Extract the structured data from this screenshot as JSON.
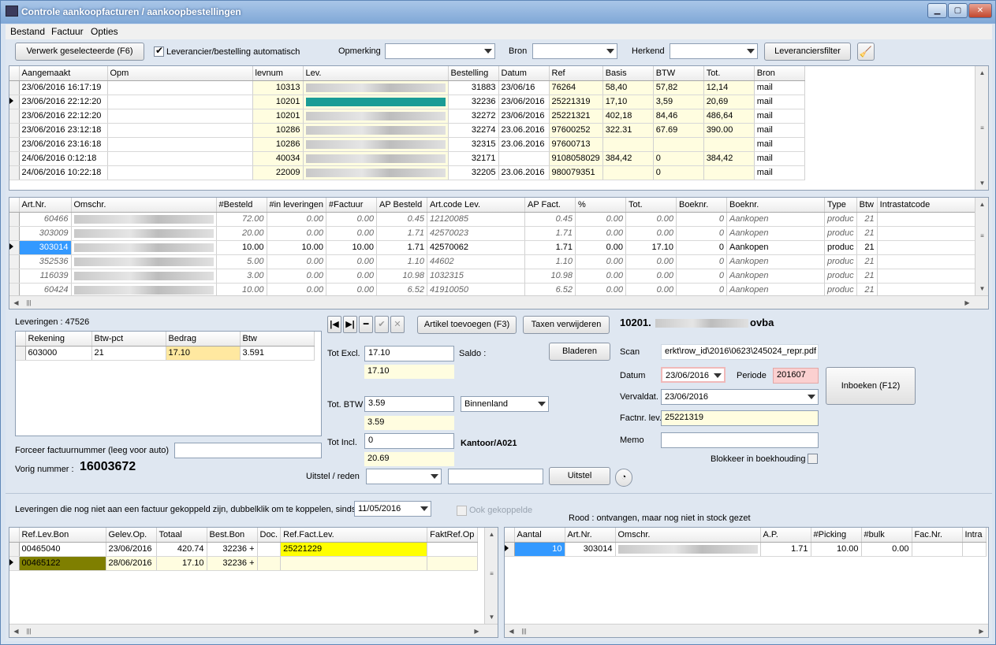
{
  "window": {
    "title": "Controle aankoopfacturen / aankoopbestellingen"
  },
  "menu": [
    "Bestand",
    "Factuur",
    "Opties"
  ],
  "toolbar": {
    "process_btn": "Verwerk geselecteerde (F6)",
    "auto_label": "Leverancier/bestelling automatisch",
    "opmerking": "Opmerking",
    "bron": "Bron",
    "herkend": "Herkend",
    "supplier_filter": "Leveranciersfilter"
  },
  "invoices": {
    "cols": [
      "Aangemaakt",
      "Opm",
      "levnum",
      "Lev.",
      "Bestelling",
      "Datum",
      "Ref",
      "Basis",
      "BTW",
      "Tot.",
      "Bron"
    ],
    "rows": [
      [
        "23/06/2016 16:17:19",
        "",
        "10313",
        "",
        "31883",
        "23/06/16",
        "76264",
        "58,40",
        "57,82",
        "12,14",
        "mail"
      ],
      [
        "23/06/2016 22:12:20",
        "",
        "10201",
        "",
        "32236",
        "23/06/2016",
        "25221319",
        "17,10",
        "3,59",
        "20,69",
        "mail"
      ],
      [
        "23/06/2016 22:12:20",
        "",
        "10201",
        "",
        "32272",
        "23/06/2016",
        "25221321",
        "402,18",
        "84,46",
        "486,64",
        "mail"
      ],
      [
        "23/06/2016 23:12:18",
        "",
        "10286",
        "",
        "32274",
        "23.06.2016",
        "97600252",
        "322.31",
        "67.69",
        "390.00",
        "mail"
      ],
      [
        "23/06/2016 23:16:18",
        "",
        "10286",
        "",
        "32315",
        "23.06.2016",
        "97600713",
        "",
        "",
        "",
        "mail"
      ],
      [
        "24/06/2016 0:12:18",
        "",
        "40034",
        "",
        "32171",
        "",
        "9108058029",
        "384,42",
        "0",
        "384,42",
        "mail"
      ],
      [
        "24/06/2016 10:22:18",
        "",
        "22009",
        "",
        "32205",
        "23.06.2016",
        "980079351",
        "",
        "0",
        "",
        "mail"
      ]
    ]
  },
  "lines": {
    "cols": [
      "Art.Nr.",
      "Omschr.",
      "#Besteld",
      "#in leveringen",
      "#Factuur",
      "AP Besteld",
      "Art.code Lev.",
      "AP Fact.",
      "%",
      "Tot.",
      "Boeknr.",
      "Boeknr.",
      "Type",
      "Btw",
      "Intrastatcode"
    ],
    "rows": [
      [
        "60466",
        "",
        "72.00",
        "0.00",
        "0.00",
        "0.45",
        "12120085",
        "0.45",
        "0.00",
        "0.00",
        "0",
        "Aankopen",
        "produc",
        "21",
        ""
      ],
      [
        "303009",
        "",
        "20.00",
        "0.00",
        "0.00",
        "1.71",
        "42570023",
        "1.71",
        "0.00",
        "0.00",
        "0",
        "Aankopen",
        "produc",
        "21",
        ""
      ],
      [
        "303014",
        "",
        "10.00",
        "10.00",
        "10.00",
        "1.71",
        "42570062",
        "1.71",
        "0.00",
        "17.10",
        "0",
        "Aankopen",
        "produc",
        "21",
        ""
      ],
      [
        "352536",
        "",
        "5.00",
        "0.00",
        "0.00",
        "1.10",
        "44602",
        "1.10",
        "0.00",
        "0.00",
        "0",
        "Aankopen",
        "produc",
        "21",
        ""
      ],
      [
        "116039",
        "",
        "3.00",
        "0.00",
        "0.00",
        "10.98",
        "1032315",
        "10.98",
        "0.00",
        "0.00",
        "0",
        "Aankopen",
        "produc",
        "21",
        ""
      ],
      [
        "60424",
        "",
        "10.00",
        "0.00",
        "0.00",
        "6.52",
        "41910050",
        "6.52",
        "0.00",
        "0.00",
        "0",
        "Aankopen",
        "produc",
        "21",
        ""
      ]
    ]
  },
  "leveringen": {
    "label": "Leveringen : 47526",
    "cols": [
      "Rekening",
      "Btw-pct",
      "Bedrag",
      "Btw"
    ],
    "rows": [
      [
        "603000",
        "21",
        "17.10",
        "3.591"
      ]
    ]
  },
  "buttons": {
    "add_article": "Artikel toevoegen (F3)",
    "remove_tax": "Taxen verwijderen",
    "browse": "Bladeren",
    "book": "Inboeken (F12)",
    "delay": "Uitstel"
  },
  "totals": {
    "excl_label": "Tot Excl.",
    "excl": "17.10",
    "excl_calc": "17.10",
    "saldo": "Saldo :",
    "btw_label": "Tot. BTW",
    "btw": "3.59",
    "btw_calc": "3.59",
    "region": "Binnenland",
    "incl_label": "Tot Incl.",
    "incl": "0",
    "incl_calc": "20.69",
    "kantoor": "Kantoor/A021",
    "uitstel_label": "Uitstel / reden"
  },
  "supplier": {
    "prefix": "10201.",
    "suffix": "ovba"
  },
  "details": {
    "scan_label": "Scan",
    "scan": "erkt\\row_id\\2016\\0623\\245024_repr.pdf",
    "datum_label": "Datum",
    "datum": "23/06/2016",
    "periode_label": "Periode",
    "periode": "201607",
    "verval_label": "Vervaldat.",
    "verval": "23/06/2016",
    "factnr_label": "Factnr. lev.",
    "factnr": "25221319",
    "memo_label": "Memo",
    "blokkeer": "Blokkeer in boekhouding"
  },
  "force": {
    "label": "Forceer factuurnummer (leeg voor auto)",
    "prev_label": "Vorig nummer :",
    "prev": "16003672"
  },
  "bottom": {
    "label": "Leveringen die nog niet aan een factuur gekoppeld zijn, dubbelklik om te koppelen, sinds",
    "since": "11/05/2016",
    "ook": "Ook gekoppelde",
    "rood": "Rood : ontvangen, maar nog niet in stock gezet"
  },
  "deliveries": {
    "cols": [
      "Ref.Lev.Bon",
      "Gelev.Op.",
      "Totaal",
      "Best.Bon",
      "Doc.",
      "Ref.Fact.Lev.",
      "FaktRef.Op"
    ],
    "rows": [
      [
        "00465040",
        "23/06/2016",
        "420.74",
        "32236 +",
        "",
        "25221229",
        ""
      ],
      [
        "00465122",
        "28/06/2016",
        "17.10",
        "32236 +",
        "",
        "",
        ""
      ]
    ]
  },
  "dlines": {
    "cols": [
      "Aantal",
      "Art.Nr.",
      "Omschr.",
      "A.P.",
      "#Picking",
      "#bulk",
      "Fac.Nr.",
      "Intra"
    ],
    "rows": [
      [
        "10",
        "303014",
        "",
        "1.71",
        "10.00",
        "0.00",
        "",
        ""
      ]
    ]
  }
}
